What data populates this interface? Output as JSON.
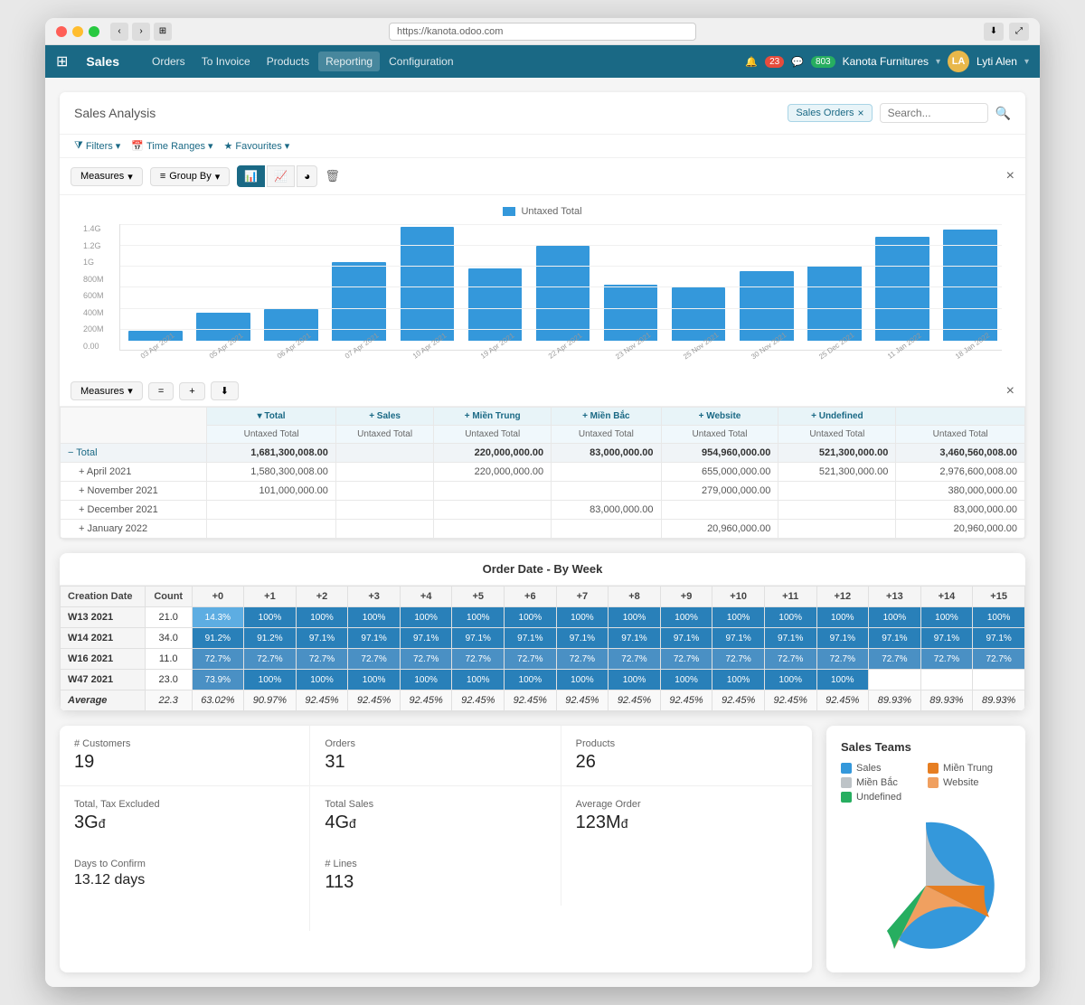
{
  "window": {
    "url": "https://kanota.odoo.com",
    "title": "Sales"
  },
  "header": {
    "app_icon": "⊞",
    "title": "Sales",
    "nav": [
      "Orders",
      "To Invoice",
      "Products",
      "Reporting",
      "Configuration"
    ],
    "notifications": "23",
    "messages": "803",
    "company": "Kanota Furnitures",
    "user": "Lyti Alen",
    "avatar_initials": "LA"
  },
  "page": {
    "title": "Sales Analysis",
    "search_tag": "Sales Orders",
    "search_placeholder": "Search...",
    "filters_label": "Filters",
    "time_ranges_label": "Time Ranges",
    "favourites_label": "Favourites"
  },
  "chart": {
    "legend_label": "Untaxed Total",
    "measures_label": "Measures",
    "group_by_label": "Group By",
    "y_labels": [
      "1.4G",
      "1.2G",
      "1G",
      "800M",
      "600M",
      "400M",
      "200M",
      "0.00"
    ],
    "bars": [
      {
        "label": "03 Apr 2021",
        "height_pct": 8
      },
      {
        "label": "05 Apr 2021",
        "height_pct": 22
      },
      {
        "label": "06 Apr 2021",
        "height_pct": 25
      },
      {
        "label": "07 Apr 2021",
        "height_pct": 62
      },
      {
        "label": "10 Apr 2021",
        "height_pct": 90
      },
      {
        "label": "19 Apr 2021",
        "height_pct": 57
      },
      {
        "label": "22 Apr 2021",
        "height_pct": 75
      },
      {
        "label": "23 Nov 2021",
        "height_pct": 44
      },
      {
        "label": "25 Nov 2021",
        "height_pct": 42
      },
      {
        "label": "30 Nov 2021",
        "height_pct": 55
      },
      {
        "label": "25 Dec 2021",
        "height_pct": 59
      },
      {
        "label": "11 Jan 2022",
        "height_pct": 82
      },
      {
        "label": "18 Jan 2022",
        "height_pct": 88
      }
    ]
  },
  "pivot": {
    "measures_label": "Measures",
    "col_headers": [
      "Sales",
      "Miền Trung",
      "Miền Bắc",
      "Website",
      "Undefined"
    ],
    "sub_header": "Untaxed Total",
    "total_label": "Total",
    "total_value": "1,681,300,008.00",
    "mien_trung_total": "220,000,000.00",
    "mien_bac_total": "83,000,000.00",
    "website_total": "954,960,000.00",
    "undefined_total": "521,300,000.00",
    "grand_total": "3,460,560,008.00",
    "rows": [
      {
        "label": "April 2021",
        "sales": "1,580,300,008.00",
        "mien_trung": "220,000,000.00",
        "mien_bac": "",
        "website": "655,000,000.00",
        "undefined": "521,300,000.00",
        "grand": "2,976,600,008.00"
      },
      {
        "label": "November 2021",
        "sales": "101,000,000.00",
        "mien_trung": "",
        "mien_bac": "",
        "website": "279,000,000.00",
        "undefined": "",
        "grand": "380,000,000.00"
      },
      {
        "label": "December 2021",
        "sales": "",
        "mien_trung": "",
        "mien_bac": "83,000,000.00",
        "website": "",
        "undefined": "",
        "grand": "83,000,000.00"
      },
      {
        "label": "January 2022",
        "sales": "",
        "mien_trung": "",
        "mien_bac": "",
        "website": "20,960,000.00",
        "undefined": "",
        "grand": "20,960,000.00"
      }
    ]
  },
  "cohort": {
    "title": "Order Date - By Week",
    "col_header_creation": "Creation Date",
    "col_header_count": "Count",
    "plus_cols": [
      "+0",
      "+1",
      "+2",
      "+3",
      "+4",
      "+5",
      "+6",
      "+7",
      "+8",
      "+9",
      "+10",
      "+11",
      "+12",
      "+13",
      "+14",
      "+15"
    ],
    "rows": [
      {
        "period": "W13 2021",
        "count": "21.0",
        "values": [
          "14.3%",
          "100%",
          "100%",
          "100%",
          "100%",
          "100%",
          "100%",
          "100%",
          "100%",
          "100%",
          "100%",
          "100%",
          "100%",
          "100%",
          "100%",
          "100%"
        ],
        "styles": [
          "light",
          "dark",
          "dark",
          "dark",
          "dark",
          "dark",
          "dark",
          "dark",
          "dark",
          "dark",
          "dark",
          "dark",
          "dark",
          "dark",
          "dark",
          "dark"
        ]
      },
      {
        "period": "W14 2021",
        "count": "34.0",
        "values": [
          "91.2%",
          "91.2%",
          "97.1%",
          "97.1%",
          "97.1%",
          "97.1%",
          "97.1%",
          "97.1%",
          "97.1%",
          "97.1%",
          "97.1%",
          "97.1%",
          "97.1%",
          "97.1%",
          "97.1%",
          "97.1%"
        ],
        "styles": [
          "dark",
          "dark",
          "dark",
          "dark",
          "dark",
          "dark",
          "dark",
          "dark",
          "dark",
          "dark",
          "dark",
          "dark",
          "dark",
          "dark",
          "dark",
          "dark"
        ]
      },
      {
        "period": "W16 2021",
        "count": "11.0",
        "values": [
          "72.7%",
          "72.7%",
          "72.7%",
          "72.7%",
          "72.7%",
          "72.7%",
          "72.7%",
          "72.7%",
          "72.7%",
          "72.7%",
          "72.7%",
          "72.7%",
          "72.7%",
          "72.7%",
          "72.7%",
          "72.7%"
        ],
        "styles": [
          "medium",
          "medium",
          "medium",
          "medium",
          "medium",
          "medium",
          "medium",
          "medium",
          "medium",
          "medium",
          "medium",
          "medium",
          "medium",
          "medium",
          "medium",
          "medium"
        ]
      },
      {
        "period": "W47 2021",
        "count": "23.0",
        "values": [
          "73.9%",
          "100%",
          "100%",
          "100%",
          "100%",
          "100%",
          "100%",
          "100%",
          "100%",
          "100%",
          "100%",
          "100%",
          "100%",
          "",
          "",
          ""
        ],
        "styles": [
          "medium",
          "dark",
          "dark",
          "dark",
          "dark",
          "dark",
          "dark",
          "dark",
          "dark",
          "dark",
          "dark",
          "dark",
          "dark",
          "empty",
          "empty",
          "empty"
        ]
      }
    ],
    "avg_row": {
      "label": "Average",
      "count": "22.3",
      "values": [
        "63.02%",
        "90.97%",
        "92.45%",
        "92.45%",
        "92.45%",
        "92.45%",
        "92.45%",
        "92.45%",
        "92.45%",
        "92.45%",
        "92.45%",
        "92.45%",
        "92.45%",
        "89.93%",
        "89.93%",
        "89.93%"
      ]
    }
  },
  "kpi": {
    "customers_label": "# Customers",
    "customers_value": "19",
    "orders_label": "Orders",
    "orders_value": "31",
    "products_label": "Products",
    "products_value": "26",
    "total_tax_label": "Total, Tax Excluded",
    "total_tax_value": "3G",
    "total_sales_label": "Total Sales",
    "total_sales_value": "4G",
    "avg_order_label": "Average Order",
    "avg_order_value": "123M",
    "days_confirm_label": "Days to Confirm",
    "days_confirm_value": "13.12 days",
    "lines_label": "# Lines",
    "lines_value": "113",
    "currency": "đ"
  },
  "sales_teams": {
    "title": "Sales Teams",
    "legend": [
      {
        "label": "Sales",
        "color": "#3498db"
      },
      {
        "label": "Miền Trung",
        "color": "#e67e22"
      },
      {
        "label": "Miền Bắc",
        "color": "#bdc3c7"
      },
      {
        "label": "Website",
        "color": "#f39c12"
      },
      {
        "label": "Undefined",
        "color": "#27ae60"
      }
    ],
    "pie_segments": [
      {
        "label": "Sales",
        "color": "#3498db",
        "start": 0,
        "end": 160
      },
      {
        "label": "Undefined",
        "color": "#27ae60",
        "start": 160,
        "end": 220
      },
      {
        "label": "Website",
        "color": "#f0a060",
        "start": 220,
        "end": 320
      },
      {
        "label": "Miền Trung",
        "color": "#e67e22",
        "start": 320,
        "end": 340
      },
      {
        "label": "Miền Bắc",
        "color": "#bdc3c7",
        "start": 340,
        "end": 360
      }
    ]
  }
}
